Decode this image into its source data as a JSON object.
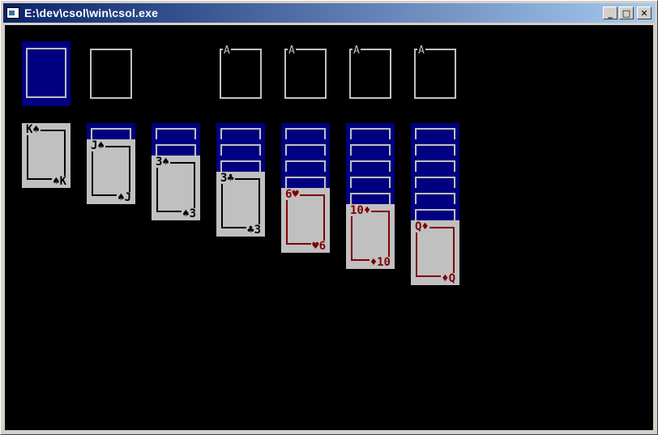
{
  "window": {
    "title": "E:\\dev\\csol\\win\\csol.exe",
    "app_icon": "console-window-icon",
    "buttons": [
      {
        "name": "minimize-button",
        "glyph": "_"
      },
      {
        "name": "maximize-button",
        "glyph": "□"
      },
      {
        "name": "close-button",
        "glyph": "✕"
      }
    ]
  },
  "colors": {
    "table": "#000000",
    "card_back": "#000080",
    "card_face": "#c0c0c0",
    "red_suit": "#800000",
    "black_suit": "#000000",
    "outline": "#c0c0c0"
  },
  "stock": {
    "state": "face-down"
  },
  "waste": {
    "state": "empty"
  },
  "foundations": [
    {
      "label": "A"
    },
    {
      "label": "A"
    },
    {
      "label": "A"
    },
    {
      "label": "A"
    }
  ],
  "tableau": [
    {
      "facedown": 0,
      "card": {
        "rank": "K",
        "suit": "♠",
        "tl": "K♠",
        "br": "♠K",
        "color": "black"
      }
    },
    {
      "facedown": 1,
      "card": {
        "rank": "J",
        "suit": "♠",
        "tl": "J♠",
        "br": "♠J",
        "color": "black"
      }
    },
    {
      "facedown": 2,
      "card": {
        "rank": "3",
        "suit": "♠",
        "tl": "3♠",
        "br": "♠3",
        "color": "black"
      }
    },
    {
      "facedown": 3,
      "card": {
        "rank": "3",
        "suit": "♣",
        "tl": "3♣",
        "br": "♣3",
        "color": "black"
      }
    },
    {
      "facedown": 4,
      "card": {
        "rank": "6",
        "suit": "♥",
        "tl": "6♥",
        "br": "♥6",
        "color": "red"
      }
    },
    {
      "facedown": 5,
      "card": {
        "rank": "10",
        "suit": "♦",
        "tl": "10♦",
        "br": "♦10",
        "color": "red"
      }
    },
    {
      "facedown": 6,
      "card": {
        "rank": "Q",
        "suit": "♦",
        "tl": "Q♦",
        "br": "♦Q",
        "color": "red"
      }
    }
  ]
}
